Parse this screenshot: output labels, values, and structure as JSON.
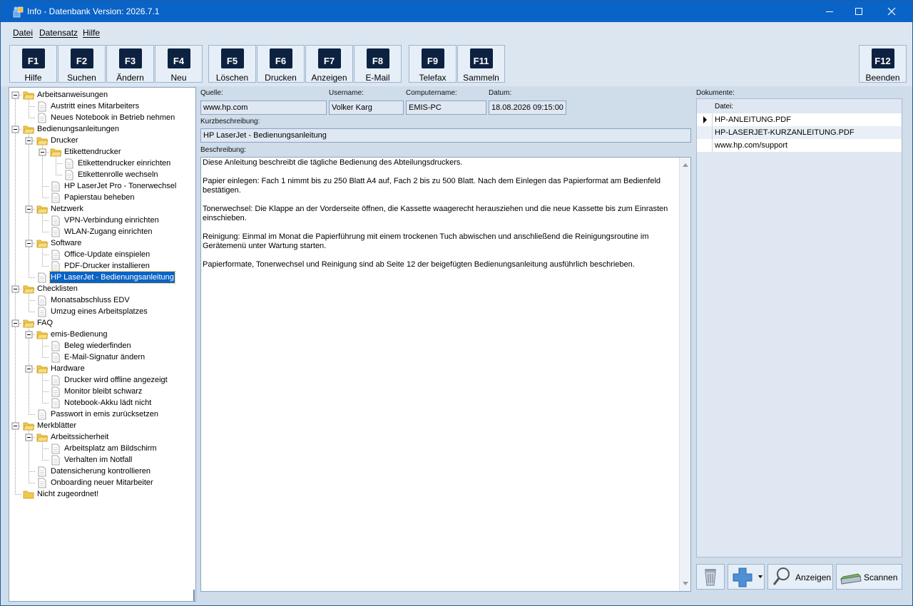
{
  "window": {
    "title": "Info - Datenbank Version: 2026.7.1",
    "controls": {
      "minimize": "minimize-icon",
      "maximize": "maximize-icon",
      "close": "close-icon"
    }
  },
  "menu": [
    {
      "label": "Datei"
    },
    {
      "label": "Datensatz"
    },
    {
      "label": "Hilfe"
    }
  ],
  "toolbar": [
    {
      "key": "F1",
      "label": "Hilfe"
    },
    {
      "key": "F2",
      "label": "Suchen"
    },
    {
      "key": "F3",
      "label": "Ändern"
    },
    {
      "key": "F4",
      "label": "Neu"
    },
    {
      "key": "F5",
      "label": "Löschen"
    },
    {
      "key": "F6",
      "label": "Drucken"
    },
    {
      "key": "F7",
      "label": "Anzeigen"
    },
    {
      "key": "F8",
      "label": "E-Mail"
    },
    {
      "key": "F9",
      "label": "Telefax"
    },
    {
      "key": "F11",
      "label": "Sammeln"
    },
    {
      "key": "F12",
      "label": "Beenden"
    }
  ],
  "tree": [
    {
      "label": "Arbeitsanweisungen",
      "level": 0,
      "type": "folder"
    },
    {
      "label": "Austritt eines Mitarbeiters",
      "level": 1,
      "type": "doc"
    },
    {
      "label": "Neues Notebook in Betrieb nehmen",
      "level": 1,
      "type": "doc"
    },
    {
      "label": "Bedienungsanleitungen",
      "level": 0,
      "type": "folder"
    },
    {
      "label": "Drucker",
      "level": 1,
      "type": "folder"
    },
    {
      "label": "Etikettendrucker",
      "level": 2,
      "type": "folder"
    },
    {
      "label": "Etikettendrucker einrichten",
      "level": 3,
      "type": "doc"
    },
    {
      "label": "Etikettenrolle wechseln",
      "level": 3,
      "type": "doc"
    },
    {
      "label": "HP LaserJet Pro - Tonerwechsel",
      "level": 2,
      "type": "doc"
    },
    {
      "label": "Papierstau beheben",
      "level": 2,
      "type": "doc"
    },
    {
      "label": "Netzwerk",
      "level": 1,
      "type": "folder"
    },
    {
      "label": "VPN-Verbindung einrichten",
      "level": 2,
      "type": "doc"
    },
    {
      "label": "WLAN-Zugang einrichten",
      "level": 2,
      "type": "doc"
    },
    {
      "label": "Software",
      "level": 1,
      "type": "folder"
    },
    {
      "label": "Office-Update einspielen",
      "level": 2,
      "type": "doc"
    },
    {
      "label": "PDF-Drucker installieren",
      "level": 2,
      "type": "doc"
    },
    {
      "label": "HP LaserJet - Bedienungsanleitung",
      "level": 1,
      "type": "doc",
      "selected": true
    },
    {
      "label": "Checklisten",
      "level": 0,
      "type": "folder"
    },
    {
      "label": "Monatsabschluss EDV",
      "level": 1,
      "type": "doc"
    },
    {
      "label": "Umzug eines Arbeitsplatzes",
      "level": 1,
      "type": "doc"
    },
    {
      "label": "FAQ",
      "level": 0,
      "type": "folder"
    },
    {
      "label": "emis-Bedienung",
      "level": 1,
      "type": "folder"
    },
    {
      "label": "Beleg wiederfinden",
      "level": 2,
      "type": "doc"
    },
    {
      "label": "E-Mail-Signatur ändern",
      "level": 2,
      "type": "doc"
    },
    {
      "label": "Hardware",
      "level": 1,
      "type": "folder"
    },
    {
      "label": "Drucker wird offline angezeigt",
      "level": 2,
      "type": "doc"
    },
    {
      "label": "Monitor bleibt schwarz",
      "level": 2,
      "type": "doc"
    },
    {
      "label": "Notebook-Akku lädt nicht",
      "level": 2,
      "type": "doc"
    },
    {
      "label": "Passwort in emis zurücksetzen",
      "level": 1,
      "type": "doc"
    },
    {
      "label": "Merkblätter",
      "level": 0,
      "type": "folder"
    },
    {
      "label": "Arbeitssicherheit",
      "level": 1,
      "type": "folder"
    },
    {
      "label": "Arbeitsplatz am Bildschirm",
      "level": 2,
      "type": "doc"
    },
    {
      "label": "Verhalten im Notfall",
      "level": 2,
      "type": "doc"
    },
    {
      "label": "Datensicherung kontrollieren",
      "level": 1,
      "type": "doc"
    },
    {
      "label": "Onboarding neuer Mitarbeiter",
      "level": 1,
      "type": "doc"
    },
    {
      "label": "Nicht zugeordnet!",
      "level": 0,
      "type": "folder",
      "leaf": true
    }
  ],
  "detail": {
    "quelle_label": "Quelle:",
    "quelle": "www.hp.com",
    "username_label": "Username:",
    "username": "Volker Karg",
    "computer_label": "Computername:",
    "computer": "EMIS-PC",
    "datum_label": "Datum:",
    "datum": "18.08.2026 09:15:00",
    "kurz_label": "Kurzbeschreibung:",
    "kurz": "HP LaserJet - Bedienungsanleitung",
    "beschreibung_label": "Beschreibung:",
    "beschreibung": "Diese Anleitung beschreibt die tägliche Bedienung des Abteilungsdruckers.\n\nPapier einlegen: Fach 1 nimmt bis zu 250 Blatt A4 auf, Fach 2 bis zu 500 Blatt. Nach dem Einlegen das Papierformat am Bedienfeld bestätigen.\n\nTonerwechsel: Die Klappe an der Vorderseite öffnen, die Kassette waagerecht herausziehen und die neue Kassette bis zum Einrasten einschieben.\n\nReinigung: Einmal im Monat die Papierführung mit einem trockenen Tuch abwischen und anschließend die Reinigungsroutine im Gerätemenü unter Wartung starten.\n\nPapierformate, Tonerwechsel und Reinigung sind ab Seite 12 der beigefügten Bedienungsanleitung ausführlich beschrieben."
  },
  "documents": {
    "label": "Dokumente:",
    "column": "Datei:",
    "rows": [
      "HP-ANLEITUNG.PDF",
      "HP-LASERJET-KURZANLEITUNG.PDF",
      "www.hp.com/support"
    ],
    "current_row": 0
  },
  "bottom_buttons": {
    "delete_icon": "recycle-bin-icon",
    "add_icon": "plus-icon",
    "view_label": "Anzeigen",
    "scan_label": "Scannen"
  },
  "colors": {
    "titlebar": "#0a63c6",
    "selection": "#0a63c6",
    "key_cap": "#0d2240",
    "window_bg": "#cfdcea"
  }
}
